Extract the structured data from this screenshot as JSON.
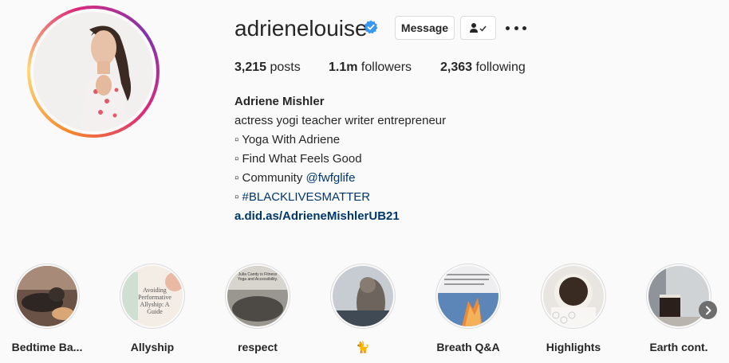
{
  "profile": {
    "username": "adrienelouise",
    "verified_icon": "verified-badge-icon",
    "message_label": "Message",
    "follow_icon": "person-check-icon",
    "more_icon": "more-options-icon"
  },
  "stats": {
    "posts_count": "3,215",
    "posts_label": "posts",
    "followers_count": "1.1m",
    "followers_label": "followers",
    "following_count": "2,363",
    "following_label": "following"
  },
  "bio": {
    "full_name": "Adriene Mishler",
    "tagline": "actress yogi teacher writer entrepreneur",
    "line1": "▫ Yoga With Adriene",
    "line2": "▫ Find What Feels Good",
    "line3_prefix": "▫ Community ",
    "line3_mention": "@fwfglife",
    "line4_prefix": "▫ ",
    "line4_hashtag": "#BLACKLIVESMATTER",
    "website": "a.did.as/AdrieneMishlerUB21"
  },
  "highlights": [
    {
      "label": "Bedtime Ba..."
    },
    {
      "label": "Allyship",
      "cover_text": "Avoiding Performative Allyship: A Guide"
    },
    {
      "label": "respect",
      "cover_text": "Julia Candy is Fitness Yoga and Accessibility."
    },
    {
      "label": "🐈"
    },
    {
      "label": "Breath Q&A"
    },
    {
      "label": "Highlights"
    },
    {
      "label": "Earth cont."
    }
  ],
  "colors": {
    "link": "#00376b",
    "verified": "#3897f0",
    "text": "#262626",
    "border": "#dbdbdb"
  }
}
